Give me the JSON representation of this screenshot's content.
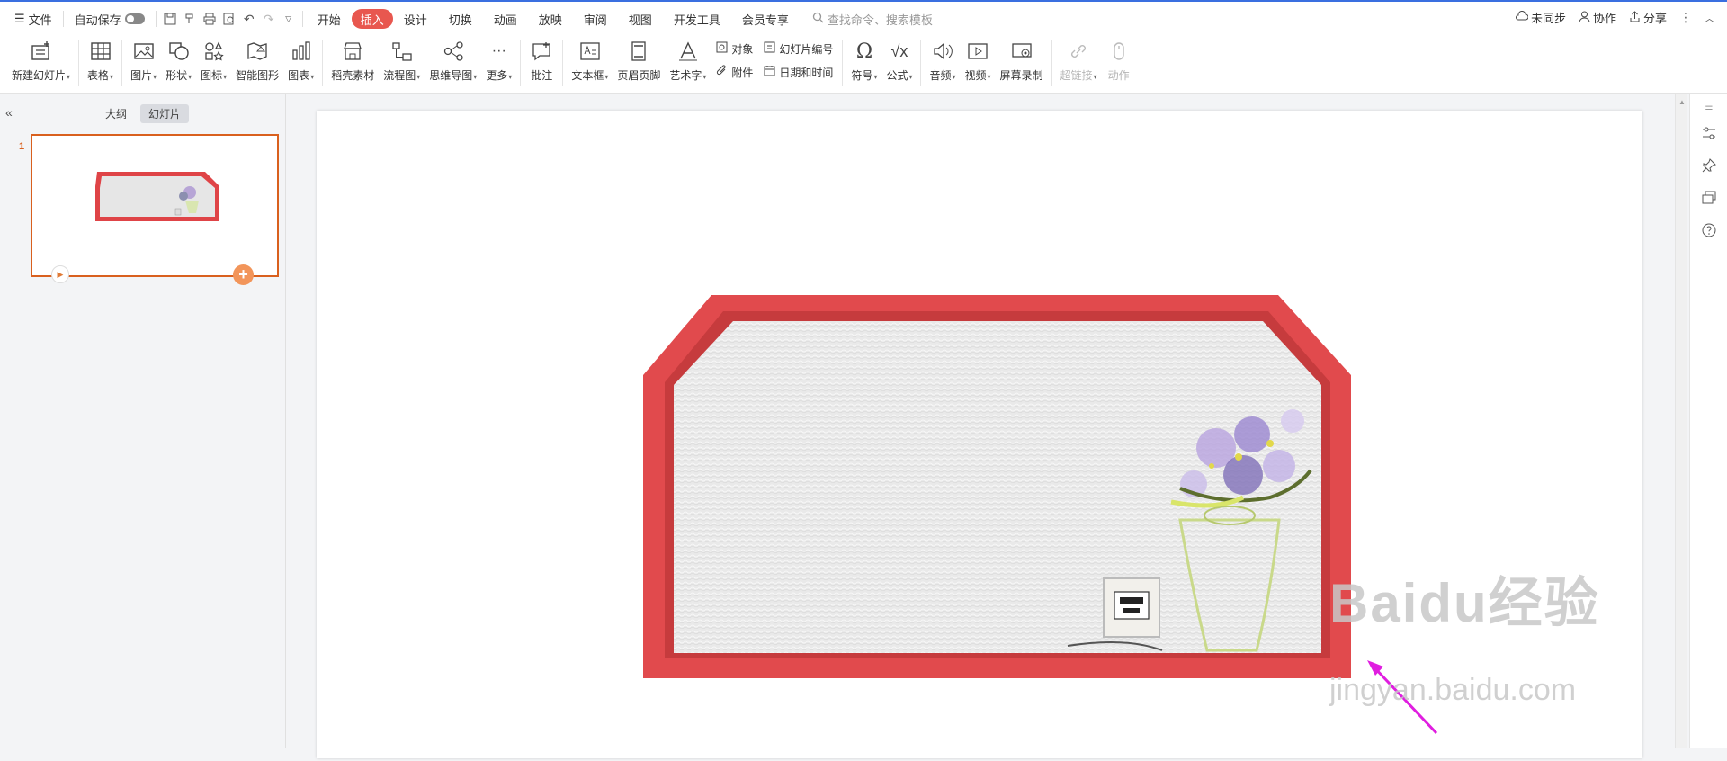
{
  "topbar": {
    "file_label": "文件",
    "autosave_label": "自动保存",
    "tabs": [
      "开始",
      "插入",
      "设计",
      "切换",
      "动画",
      "放映",
      "审阅",
      "视图",
      "开发工具",
      "会员专享"
    ],
    "active_tab": "插入",
    "search_placeholder": "查找命令、搜索模板",
    "sync_label": "未同步",
    "collab_label": "协作",
    "share_label": "分享",
    "accent_color": "#e8574f"
  },
  "ribbon": {
    "new_slide": "新建幻灯片",
    "table": "表格",
    "picture": "图片",
    "shape": "形状",
    "icon": "图标",
    "smartart": "智能图形",
    "chart": "图表",
    "material": "稻壳素材",
    "flowchart": "流程图",
    "mindmap": "思维导图",
    "more": "更多",
    "comment": "批注",
    "textbox": "文本框",
    "header_footer": "页眉页脚",
    "wordart": "艺术字",
    "object": "对象",
    "attachment": "附件",
    "slide_number": "幻灯片编号",
    "date_time": "日期和时间",
    "symbol": "符号",
    "formula": "公式",
    "audio": "音频",
    "video": "视频",
    "screen_record": "屏幕录制",
    "hyperlink": "超链接",
    "action": "动作"
  },
  "left_panel": {
    "outline_tab": "大纲",
    "slides_tab": "幻灯片",
    "active_tab": "幻灯片",
    "slide_number": "1"
  },
  "watermark": {
    "brand": "Baidu经验",
    "url": "jingyan.baidu.com"
  }
}
